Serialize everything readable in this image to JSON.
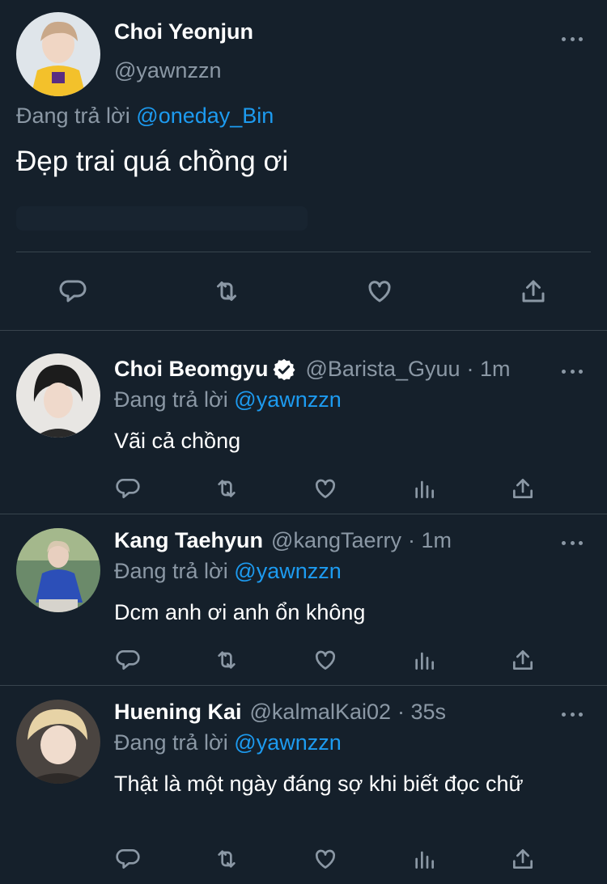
{
  "main_tweet": {
    "name": "Choi Yeonjun",
    "handle": "@yawnzzn",
    "replying_prefix": "Đang trả lời",
    "replying_to": "@oneday_Bin",
    "text": "Đẹp trai quá chồng ơi",
    "actions": [
      "reply-icon",
      "retweet-icon",
      "like-icon",
      "share-icon"
    ]
  },
  "replies": [
    {
      "name": "Choi Beomgyu",
      "verified": true,
      "handle": "@Barista_Gyuu",
      "time": "· 1m",
      "replying_prefix": "Đang trả lời",
      "replying_to": "@yawnzzn",
      "text": "Vãi cả chồng"
    },
    {
      "name": "Kang Taehyun",
      "verified": false,
      "handle": "@kangTaerry",
      "time": "· 1m",
      "replying_prefix": "Đang trả lời",
      "replying_to": "@yawnzzn",
      "text": "Dcm anh ơi anh ổn không"
    },
    {
      "name": "Huening Kai",
      "verified": false,
      "handle": "@kalmalKai02",
      "time": "· 35s",
      "replying_prefix": "Đang trả lời",
      "replying_to": "@yawnzzn",
      "text": "Thật là một ngày đáng sợ khi biết đọc chữ"
    }
  ],
  "colors": {
    "background": "#15202b",
    "muted": "#8b98a5",
    "link": "#1d9bf0",
    "divider": "#38444d"
  }
}
